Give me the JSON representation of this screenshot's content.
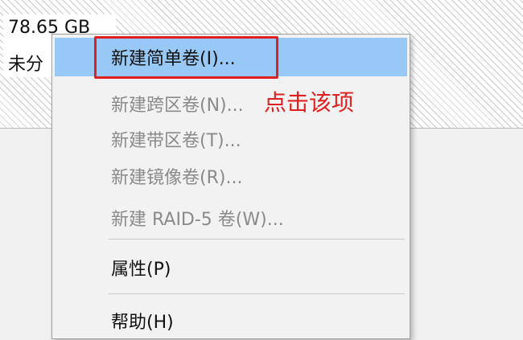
{
  "volume": {
    "size": "78.65 GB",
    "status": "未分"
  },
  "context_menu": {
    "items": [
      {
        "label": "新建简单卷(I)...",
        "enabled": true,
        "highlighted": true
      },
      {
        "label": "新建跨区卷(N)...",
        "enabled": false
      },
      {
        "label": "新建带区卷(T)...",
        "enabled": false
      },
      {
        "label": "新建镜像卷(R)...",
        "enabled": false
      },
      {
        "label": "新建 RAID-5 卷(W)...",
        "enabled": false
      },
      {
        "label": "属性(P)",
        "enabled": true
      },
      {
        "label": "帮助(H)",
        "enabled": true
      }
    ]
  },
  "annotation": {
    "text": "点击该项",
    "color": "#e02020"
  },
  "colors": {
    "highlight": "#98c8f5",
    "annotation_red": "#e02020",
    "disabled_text": "#8a8a8a"
  }
}
